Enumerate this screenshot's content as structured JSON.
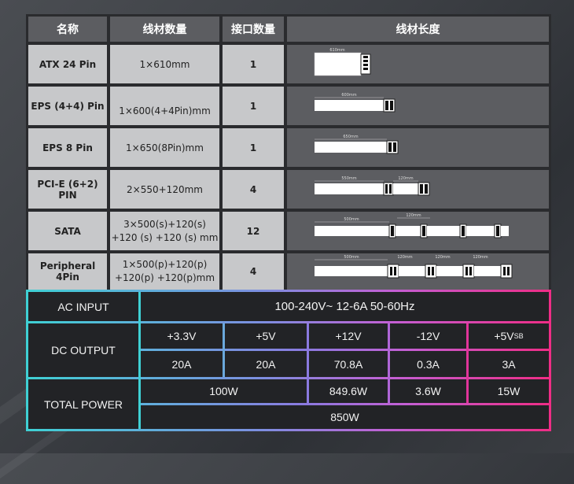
{
  "cable_table": {
    "headers": [
      "名称",
      "线材数量",
      "接口数量",
      "线材长度"
    ],
    "rows": [
      {
        "name": "ATX 24 Pin",
        "cable": "1×610mm",
        "pins": "1",
        "diagram": {
          "segments": [
            "610mm"
          ]
        }
      },
      {
        "name": "EPS (4+4) Pin",
        "cable": "1×600(4+4Pin)mm",
        "pins": "1",
        "diagram": {
          "segments": [
            "600mm"
          ]
        }
      },
      {
        "name": "EPS 8 Pin",
        "cable": "1×650(8Pin)mm",
        "pins": "1",
        "diagram": {
          "segments": [
            "650mm"
          ]
        }
      },
      {
        "name": "PCI-E (6+2) PIN",
        "cable": "2×550+120mm",
        "pins": "4",
        "diagram": {
          "segments": [
            "550mm",
            "120mm"
          ]
        }
      },
      {
        "name": "SATA",
        "cable_line1": "3×500(s)+120(s)",
        "cable_line2": "+120 (s) +120 (s) mm",
        "pins": "12",
        "diagram": {
          "segments": [
            "500mm",
            "120mm"
          ]
        }
      },
      {
        "name": "Peripheral 4Pin",
        "cable_line1": "1×500(p)+120(p)",
        "cable_line2": "+120(p) +120(p)mm",
        "pins": "4",
        "diagram": {
          "segments": [
            "500mm",
            "120mm",
            "120mm",
            "120mm"
          ]
        }
      }
    ]
  },
  "spec_table": {
    "ac_input_label": "AC INPUT",
    "ac_input_value": "100-240V~  12-6A  50-60Hz",
    "dc_output_label": "DC OUTPUT",
    "rails": [
      {
        "rail": "+3.3V",
        "current": "20A"
      },
      {
        "rail": "+5V",
        "current": "20A"
      },
      {
        "rail": "+12V",
        "current": "70.8A"
      },
      {
        "rail": "-12V",
        "current": "0.3A"
      },
      {
        "rail_main": "+5V",
        "rail_sub": "SB",
        "current": "3A"
      }
    ],
    "total_power_label": "TOTAL POWER",
    "power_combined_3v3_5v": "100W",
    "power_12v": "849.6W",
    "power_minus12v": "3.6W",
    "power_5vsb": "15W",
    "total_power_value": "850W"
  },
  "colors": {
    "border_cyan": "#3fd0d4",
    "border_purple": "#8b7ae0",
    "border_magenta": "#ef2d86"
  }
}
